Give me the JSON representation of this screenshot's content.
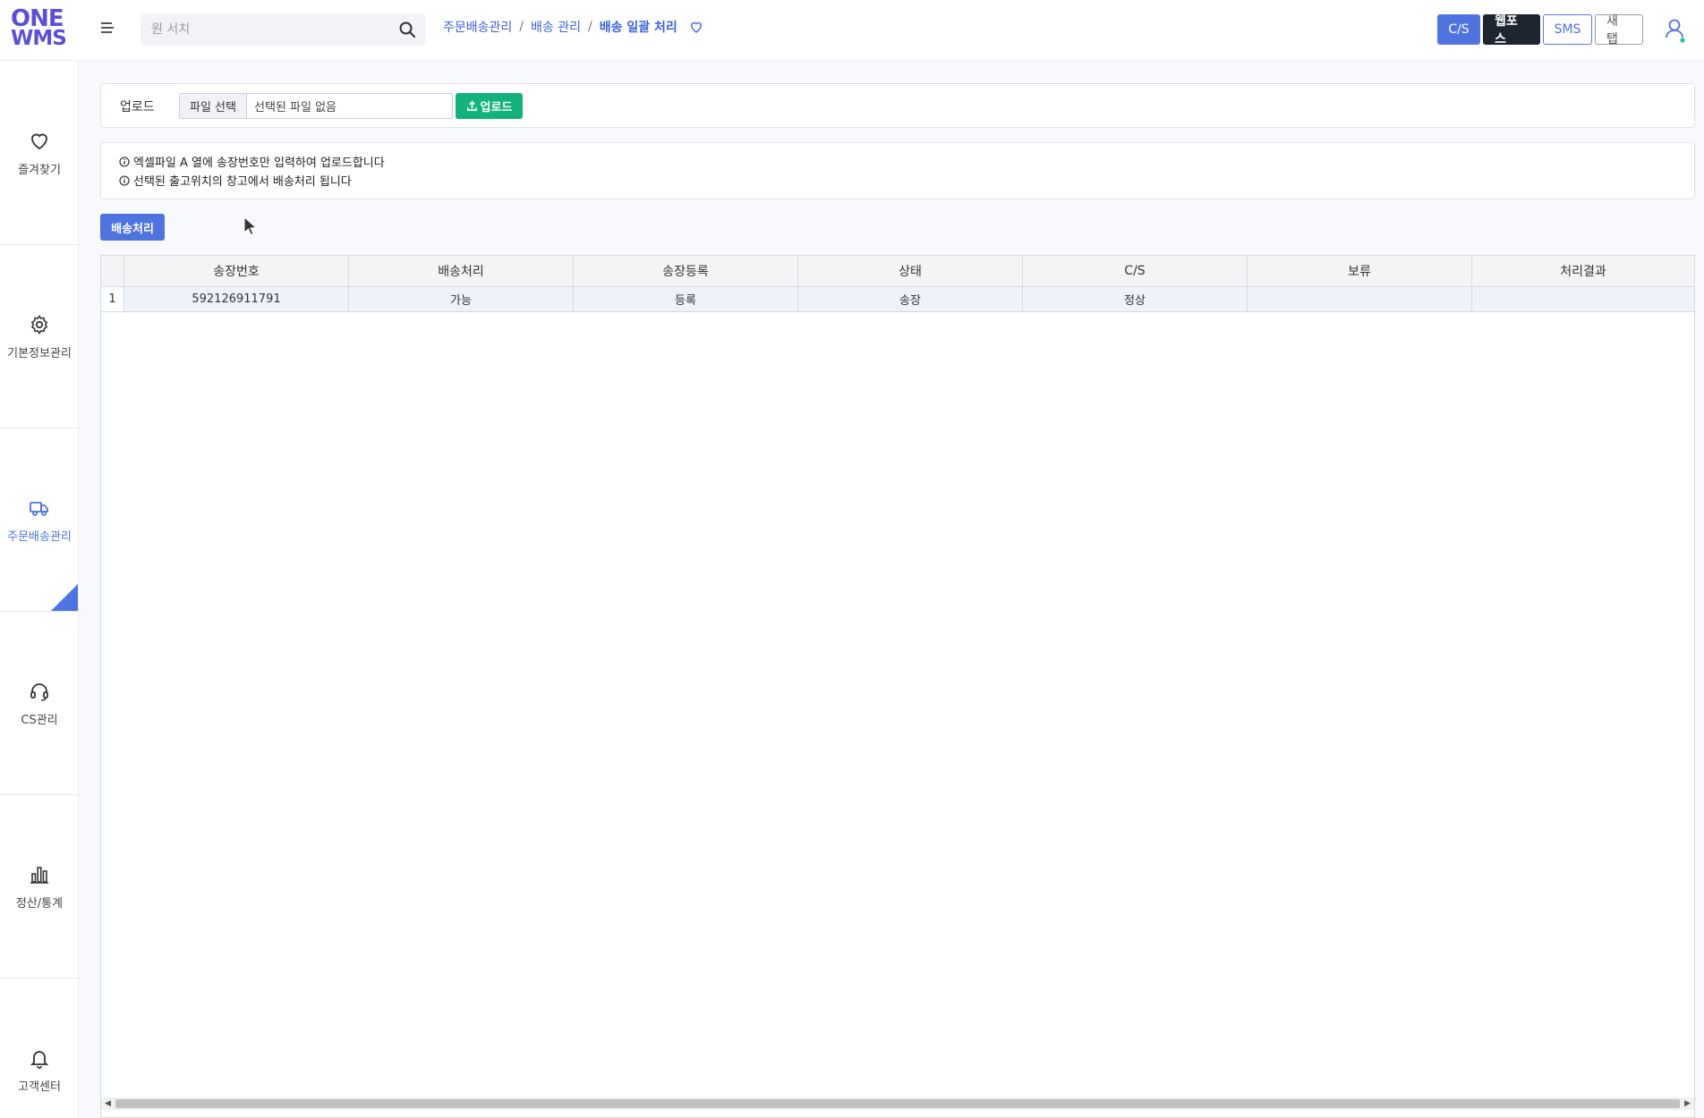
{
  "header": {
    "logo_line1": "ONE",
    "logo_line2": "WMS",
    "search_placeholder": "원 서치",
    "breadcrumb": [
      "주문배송관리",
      "배송 관리",
      "배송 일괄 처리"
    ],
    "buttons": {
      "cs": "C/S",
      "webpos": "웹포스",
      "sms": "SMS",
      "newtab": "새 탭"
    }
  },
  "sidebar": {
    "items": [
      {
        "label": "즐겨찾기",
        "icon": "heart-icon"
      },
      {
        "label": "기본정보관리",
        "icon": "gear-icon"
      },
      {
        "label": "주문배송관리",
        "icon": "truck-icon"
      },
      {
        "label": "CS관리",
        "icon": "headset-icon"
      },
      {
        "label": "정산/통계",
        "icon": "bar-chart-icon"
      },
      {
        "label": "고객센터",
        "icon": "bell-icon"
      }
    ]
  },
  "upload": {
    "label": "업로드",
    "file_button": "파일 선택",
    "file_name": "선택된 파일 없음",
    "upload_button": "업로드"
  },
  "info": {
    "line1": "엑셀파일 A 열에 송장번호만 입력하여 업로드합니다",
    "line2": "선택된 출고위치의 창고에서 배송처리 됩니다"
  },
  "action": {
    "process_button": "배송처리"
  },
  "grid": {
    "columns": [
      "송장번호",
      "배송처리",
      "송장등록",
      "상태",
      "C/S",
      "보류",
      "처리결과"
    ],
    "rows": [
      {
        "index": "1",
        "cells": [
          "592126911791",
          "가능",
          "등록",
          "송장",
          "정상",
          "",
          ""
        ]
      }
    ]
  },
  "colors": {
    "accent": "#4e73df",
    "success": "#14b27d",
    "dark": "#1f2530",
    "logo": "#5b4fd6"
  }
}
